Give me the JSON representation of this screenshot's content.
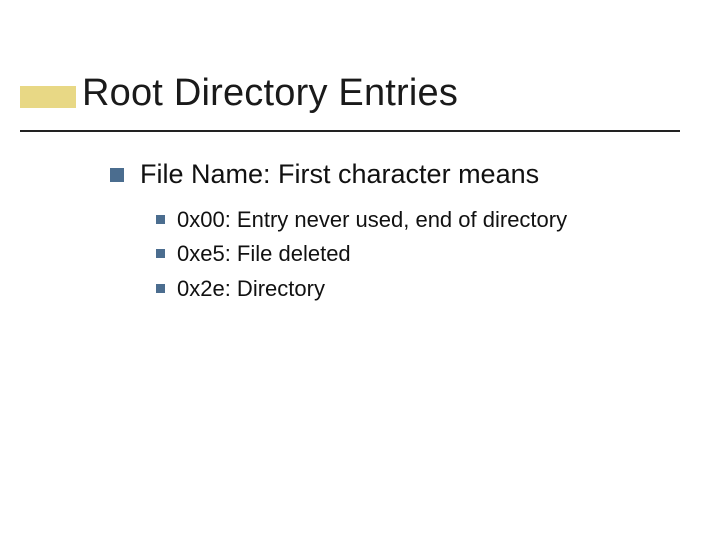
{
  "slide": {
    "title": "Root Directory Entries",
    "bullets": [
      {
        "text": "File Name: First character means",
        "children": [
          {
            "text": "0x00:  Entry never used, end of directory"
          },
          {
            "text": "0xe5:  File deleted"
          },
          {
            "text": "0x2e:  Directory"
          }
        ]
      }
    ]
  }
}
